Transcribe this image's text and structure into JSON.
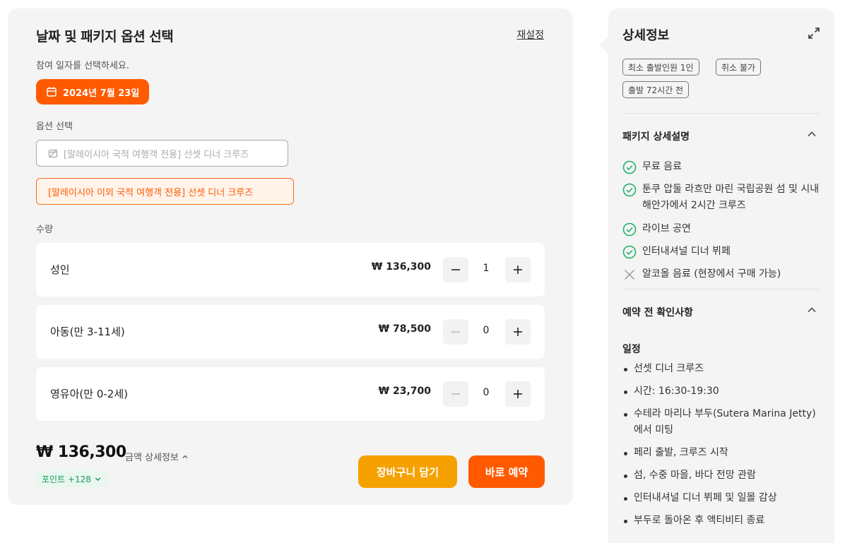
{
  "booking": {
    "title": "날짜 및 패키지 옵션 선택",
    "reset_label": "재설정",
    "date_label": "참여 일자를 선택하세요.",
    "selected_date": "2024년 7월 23일",
    "option_label": "옵션 선택",
    "options": [
      {
        "label": "[말레이시아 국적 여행객 전용] 선셋 디너 크루즈",
        "state": "unavailable"
      },
      {
        "label": "[말레이시아 이외 국적 여행객 전용] 선셋 디너 크루즈",
        "state": "selected"
      }
    ],
    "quantity_label": "수량",
    "quantities": [
      {
        "label": "성인",
        "price": "₩ 136,300",
        "count": "1"
      },
      {
        "label": "아동(만 3-11세)",
        "price": "₩ 78,500",
        "count": "0"
      },
      {
        "label": "영유아(만 0-2세)",
        "price": "₩ 23,700",
        "count": "0"
      }
    ],
    "total": "₩ 136,300",
    "price_detail_label": "금액 상세정보",
    "points": "포인트 +128",
    "cart_label": "장바구니 담기",
    "book_label": "바로 예약"
  },
  "details": {
    "title": "상세정보",
    "tags": [
      "최소 출발인원 1인",
      "취소 불가",
      "출발 72시간 전"
    ],
    "package_title": "패키지 상세설명",
    "package_features": [
      {
        "text": "무료 음료",
        "included": true
      },
      {
        "text": "툰쿠 압둘 라흐만 마린 국립공원 섬 및 시내 해안가에서 2시간 크루즈",
        "included": true
      },
      {
        "text": "라이브 공연",
        "included": true
      },
      {
        "text": "인터내셔널 디너 뷔페",
        "included": true
      },
      {
        "text": "알코올 음료 (현장에서 구매 가능)",
        "included": false
      }
    ],
    "notice_title": "예약 전 확인사항",
    "itinerary_title": "일정",
    "itinerary": [
      "선셋 디너 크루즈",
      "시간: 16:30-19:30",
      "수테라 마리나 부두(Sutera Marina Jetty)에서 미팅",
      "페리 출발, 크루즈 시작",
      "섬, 수중 마을, 바다 전망 관람",
      "인터내셔널 디너 뷔페 및 일몰 감상",
      "부두로 돌아온 후 액티비티 종료"
    ]
  },
  "colors": {
    "accent": "#ff5a00",
    "cart": "#f5a100",
    "check": "#1fb36a",
    "panel_bg": "#f4f4f4"
  }
}
